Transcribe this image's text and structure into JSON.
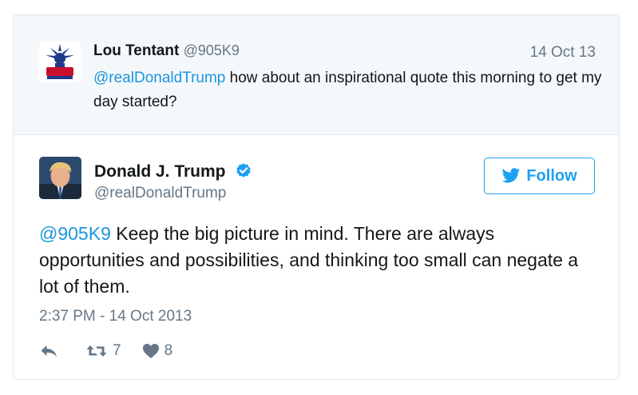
{
  "reply_tweet": {
    "name": "Lou Tentant",
    "handle": "@905K9",
    "date": "14 Oct 13",
    "mention": "@realDonaldTrump",
    "text": " how about an inspirational quote this morning to get my day started?",
    "avatar_icon": "statue-of-liberty-logo-icon",
    "avatar_text": "NYR"
  },
  "main_tweet": {
    "name": "Donald J. Trump",
    "handle": "@realDonaldTrump",
    "verified_icon": "verified-badge-icon",
    "follow_label": "Follow",
    "mention": "@905K9",
    "text": " Keep the big picture in mind. There are always opportunities and possibilities, and thinking too small can negate a lot of them.",
    "timestamp": "2:37 PM - 14 Oct 2013",
    "retweets": "7",
    "likes": "8"
  },
  "colors": {
    "link": "#1b95e0",
    "follow": "#1da1f2",
    "muted": "#657786",
    "text": "#14171a"
  }
}
